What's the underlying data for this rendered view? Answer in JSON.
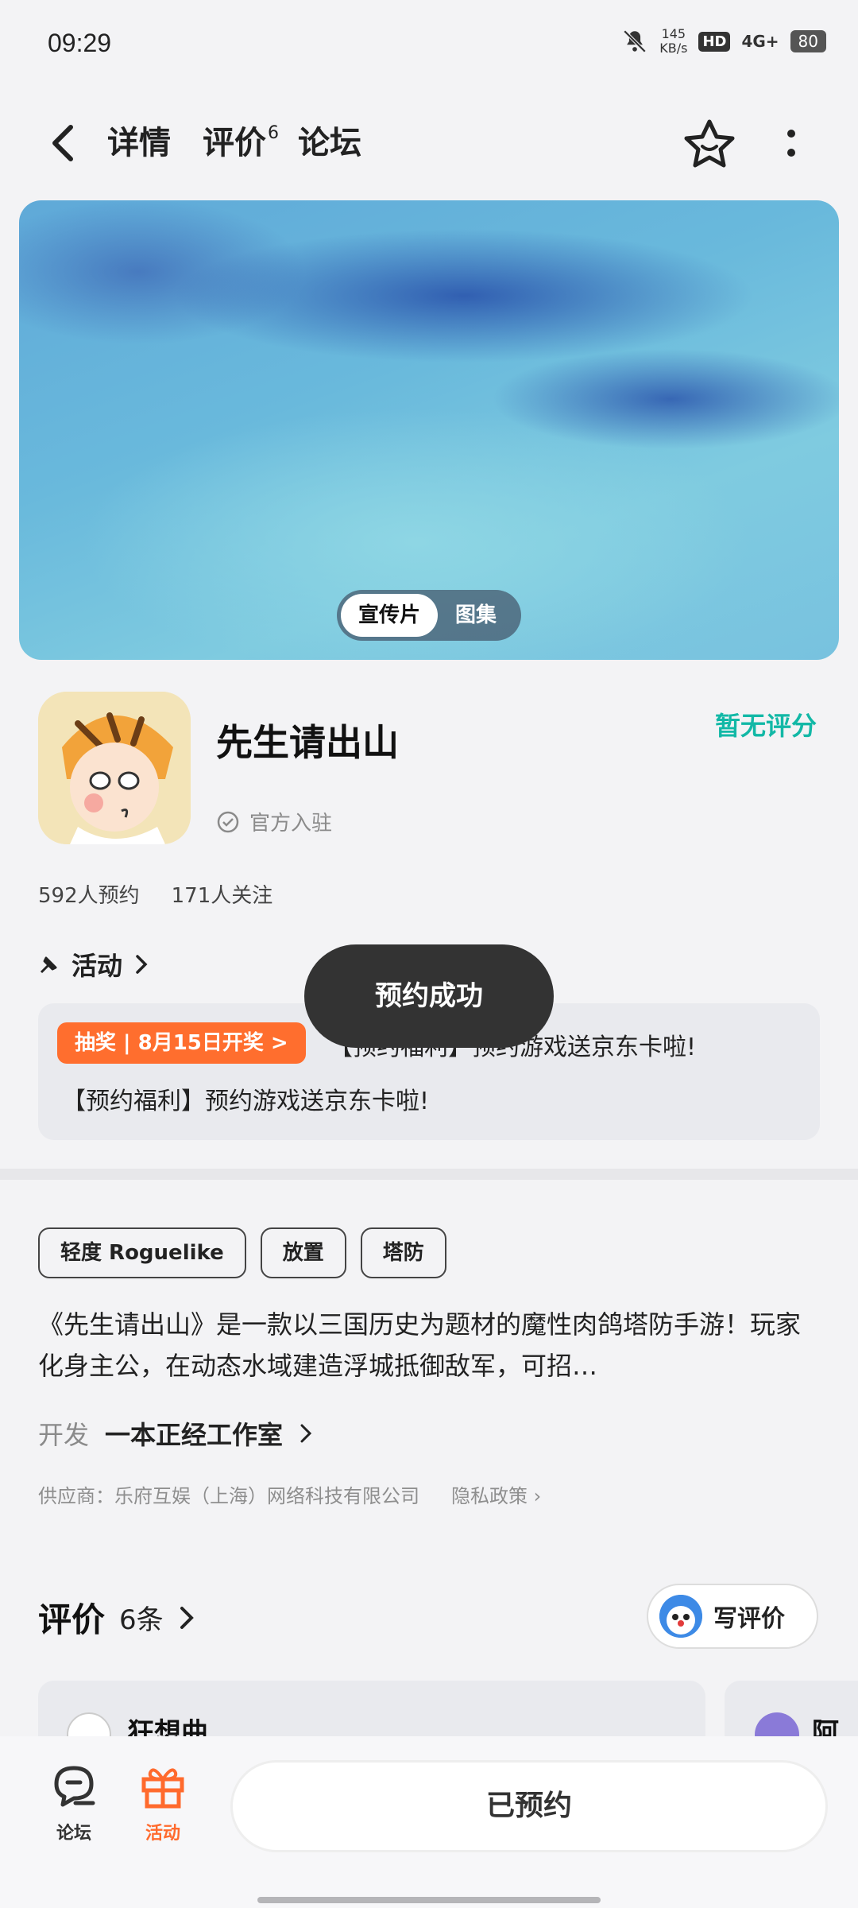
{
  "status_bar": {
    "time": "09:29",
    "net_speed_value": "145",
    "net_speed_unit": "KB/s",
    "hd": "HD",
    "network": "4G+",
    "battery": "80"
  },
  "nav": {
    "tabs": [
      {
        "label": "详情",
        "active": true
      },
      {
        "label": "评价",
        "badge": "6"
      },
      {
        "label": "论坛"
      }
    ]
  },
  "banner": {
    "switch": [
      "宣传片",
      "图集"
    ]
  },
  "game": {
    "title": "先生请出山",
    "official": "官方入驻",
    "score": "暂无评分",
    "reservations": "592人预约",
    "followers": "171人关注"
  },
  "activity": {
    "header": "活动",
    "lottery_pill": "抽奖 | 8月15日开奖 >",
    "line1": "【预约福利】预约游戏送京东卡啦!",
    "line2": "【预约福利】预约游戏送京东卡啦!"
  },
  "toast": "预约成功",
  "tags": [
    "轻度 Roguelike",
    "放置",
    "塔防"
  ],
  "description": "《先生请出山》是一款以三国历史为题材的魔性肉鸽塔防手游！玩家化身主公，在动态水域建造浮城抵御敌军，可招…",
  "developer": {
    "label": "开发",
    "name": "一本正经工作室"
  },
  "supplier": {
    "text": "供应商：乐府互娱（上海）网络科技有限公司",
    "privacy": "隐私政策"
  },
  "reviews": {
    "title": "评价",
    "count": "6条",
    "write": "写评价",
    "card1_name": "狂想曲",
    "card2_name": "阿"
  },
  "bottom": {
    "forum": "论坛",
    "activity": "活动",
    "reserved": "已预约"
  },
  "colors": {
    "accent": "#19c6b4",
    "orange": "#ff6e2e",
    "toast_bg": "#333333"
  }
}
